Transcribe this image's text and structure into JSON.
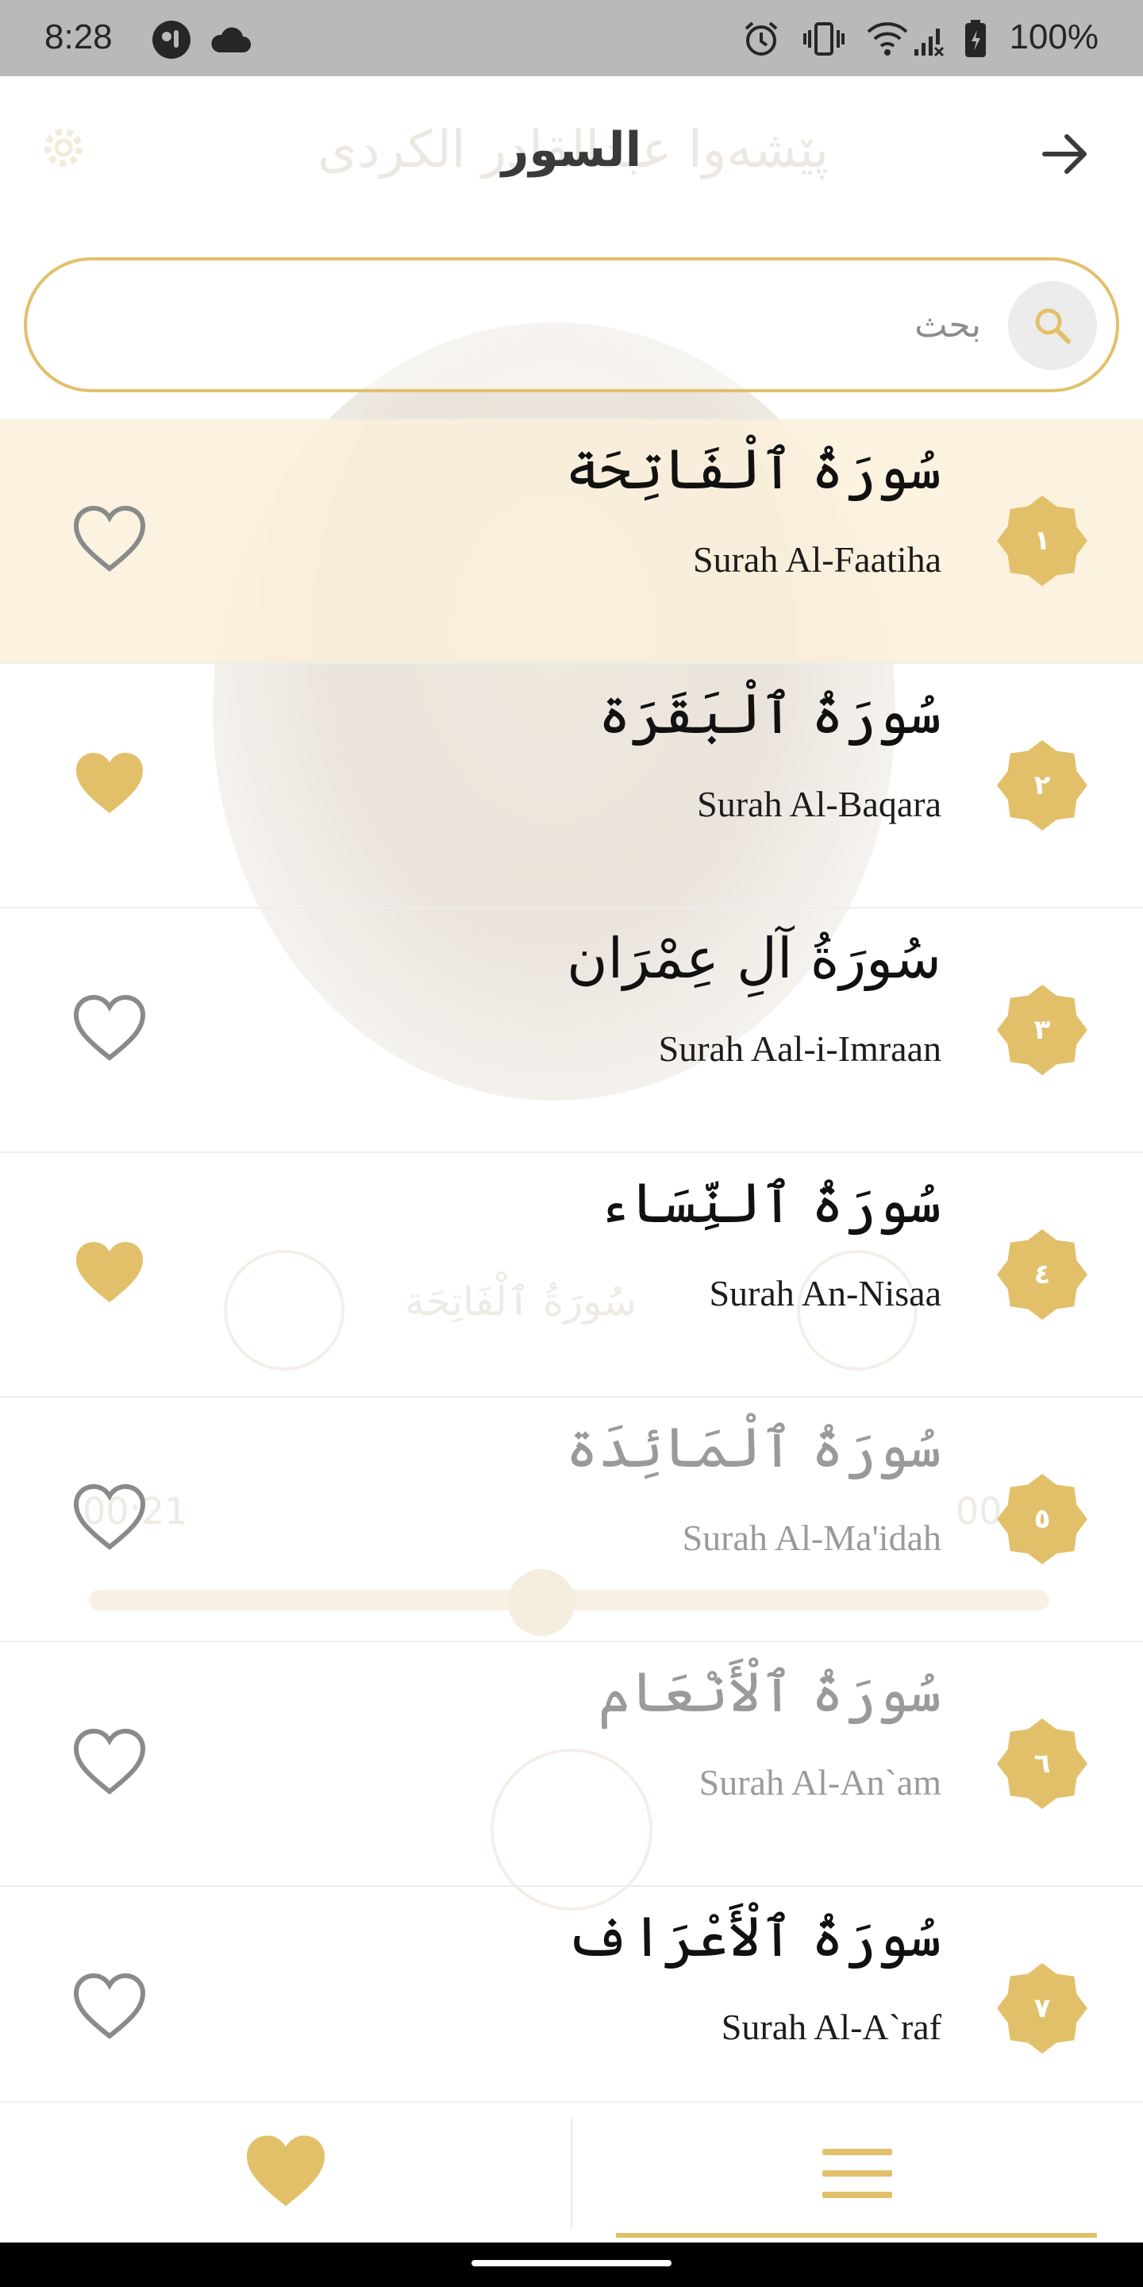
{
  "status_bar": {
    "time": "8:28",
    "battery": "100%"
  },
  "background_player": {
    "reciter_name": "پێشەوا عبدالقادر الكردى",
    "now_playing": "سُورَةُ ٱلْفَاتِحَة",
    "elapsed": "00:21",
    "duration_partial": "00"
  },
  "header": {
    "title": "السور",
    "back_icon": "arrow-right-icon"
  },
  "search": {
    "placeholder": "بحث",
    "value": "",
    "icon": "search-icon"
  },
  "colors": {
    "accent": "#e2c06a",
    "selected_row": "#faf0da",
    "heart_outline": "#8a8a8a"
  },
  "surahs": [
    {
      "number": "١",
      "arabic": "سُورَةُ ٱلْفَاتِحَة",
      "english": "Surah Al-Faatiha",
      "favorite": false,
      "selected": true
    },
    {
      "number": "٢",
      "arabic": "سُورَةُ ٱلْبَقَرَة",
      "english": "Surah Al-Baqara",
      "favorite": true,
      "selected": false
    },
    {
      "number": "٣",
      "arabic": "سُورَةُ آلِ عِمْرَان",
      "english": "Surah Aal-i-Imraan",
      "favorite": false,
      "selected": false
    },
    {
      "number": "٤",
      "arabic": "سُورَةُ ٱلنِّسَاء",
      "english": "Surah An-Nisaa",
      "favorite": true,
      "selected": false
    },
    {
      "number": "٥",
      "arabic": "سُورَةُ ٱلْمَائِدَة",
      "english": "Surah Al-Ma'idah",
      "favorite": false,
      "selected": false
    },
    {
      "number": "٦",
      "arabic": "سُورَةُ ٱلْأَنْعَام",
      "english": "Surah Al-An`am",
      "favorite": false,
      "selected": false
    },
    {
      "number": "٧",
      "arabic": "سُورَةُ ٱلْأَعْرَاف",
      "english": "Surah Al-A`raf",
      "favorite": false,
      "selected": false
    }
  ],
  "bottom_nav": {
    "items": [
      {
        "icon": "heart-icon"
      },
      {
        "icon": "menu-icon",
        "active": true
      }
    ]
  }
}
